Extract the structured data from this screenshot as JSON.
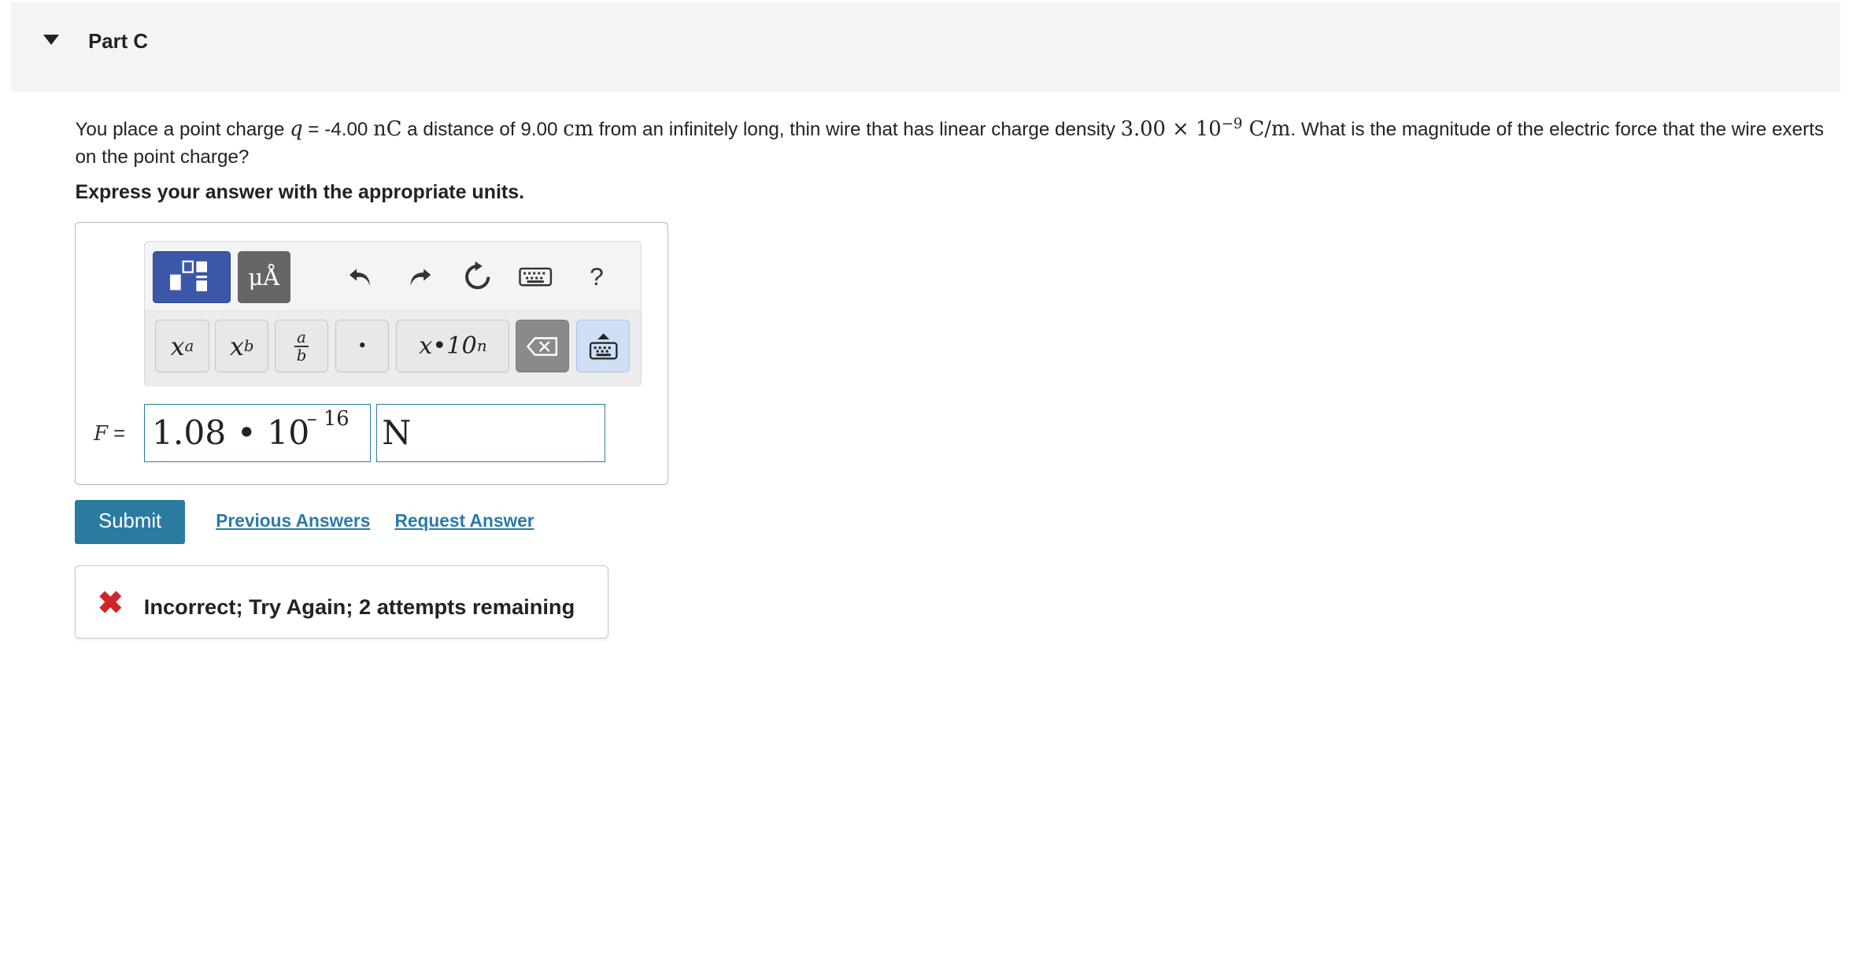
{
  "header": {
    "title": "Part C"
  },
  "question": {
    "t1": "You place a point charge ",
    "q_var": "q",
    "t2": " = -4.00 ",
    "q_unit": "nC",
    "t3": " a distance of 9.00 ",
    "d_unit": "cm",
    "t4": " from an infinitely long, thin wire that has linear charge density ",
    "lambda_mantissa": "3.00 × 10",
    "lambda_exp": "−9",
    "lambda_unit": " C/m",
    "t5": ". What is the magnitude of the electric force that the wire exerts on the point charge?"
  },
  "instruction": "Express your answer with the appropriate units.",
  "toolbar": {
    "units_label": "μÅ",
    "help_label": "?",
    "keys": {
      "superscript": {
        "base": "x",
        "sup": "a"
      },
      "subscript": {
        "base": "x",
        "sub": "b"
      },
      "fraction": {
        "num": "a",
        "den": "b"
      },
      "dot": "•",
      "sci": {
        "base": "x•10",
        "sup": "n"
      }
    }
  },
  "answer": {
    "label_var": "F",
    "label_eq": " =",
    "mantissa": "1.08 • 10",
    "exponent": "– 16",
    "units": "N"
  },
  "actions": {
    "submit": "Submit",
    "previous_answers": "Previous Answers",
    "request_answer": "Request Answer"
  },
  "feedback": {
    "icon": "✖",
    "text": "Incorrect; Try Again; 2 attempts remaining"
  },
  "colors": {
    "primary": "#2b7aa0",
    "link": "#2a7aa8",
    "error": "#d0262a",
    "template_button": "#3b58a8"
  }
}
